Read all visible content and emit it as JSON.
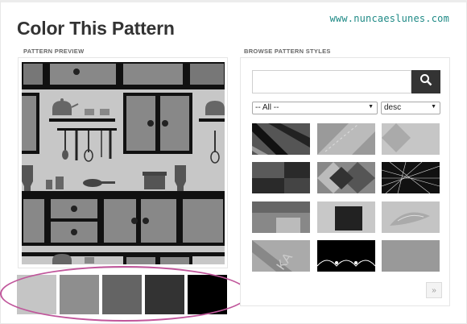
{
  "header": {
    "title": "Color This Pattern",
    "watermark": "www.nuncaeslunes.com"
  },
  "preview": {
    "label": "PATTERN PREVIEW"
  },
  "swatches": [
    {
      "name": "swatch-1",
      "color": "#c5c5c5"
    },
    {
      "name": "swatch-2",
      "color": "#8e8e8e"
    },
    {
      "name": "swatch-3",
      "color": "#646464"
    },
    {
      "name": "swatch-4",
      "color": "#333333"
    },
    {
      "name": "swatch-5",
      "color": "#000000"
    }
  ],
  "browse": {
    "label": "BROWSE PATTERN STYLES",
    "search_value": "",
    "search_icon": "search-icon",
    "filter_selected": "-- All --",
    "sort_selected": "desc",
    "next_label": "»"
  },
  "colors": {
    "accent_circle": "#c0569b",
    "watermark": "#1f8a86",
    "search_button": "#333333"
  }
}
